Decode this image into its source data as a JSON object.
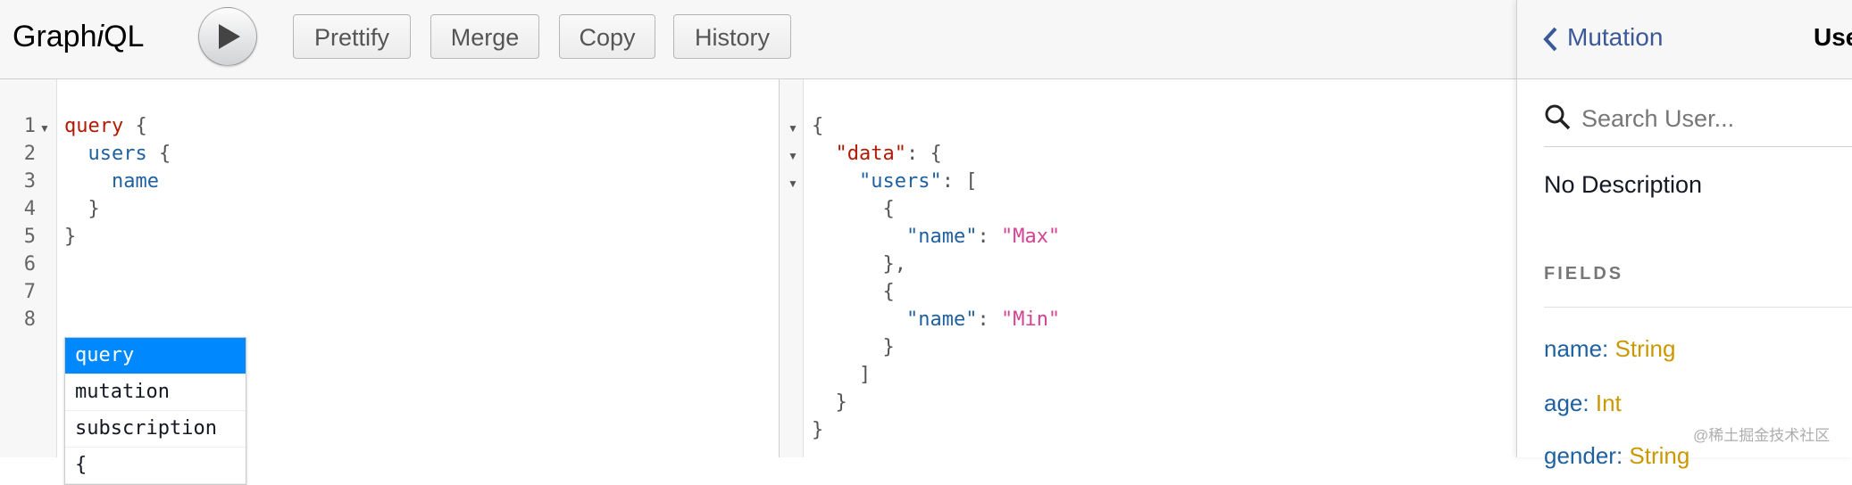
{
  "toolbar": {
    "logo_pre": "Graph",
    "logo_i": "i",
    "logo_post": "QL",
    "buttons": [
      "Prettify",
      "Merge",
      "Copy",
      "History"
    ]
  },
  "editor": {
    "line_numbers": [
      "1",
      "2",
      "3",
      "4",
      "5",
      "6",
      "7",
      "8"
    ],
    "lines": [
      [
        "query",
        " {"
      ],
      [
        "  ",
        "users",
        " {"
      ],
      [
        "    ",
        "name"
      ],
      [
        "  }"
      ],
      [
        "}"
      ]
    ],
    "autocomplete": [
      "query",
      "mutation",
      "subscription",
      "{"
    ]
  },
  "result": {
    "l1": "{",
    "data_key": "\"data\"",
    "users_key": "\"users\"",
    "name_key": "\"name\"",
    "val1": "\"Max\"",
    "val2": "\"Min\""
  },
  "docs": {
    "back_label": "Mutation",
    "title": "User",
    "search_placeholder": "Search User...",
    "description": "No Description",
    "fields_heading": "FIELDS",
    "fields": [
      {
        "name": "name",
        "type": "String"
      },
      {
        "name": "age",
        "type": "Int"
      },
      {
        "name": "gender",
        "type": "String"
      }
    ]
  },
  "watermark": "@稀土掘金技术社区",
  "colors": {
    "keyword": "#b11a04",
    "field": "#1f61a0",
    "string": "#d64292",
    "type": "#ca9800",
    "link": "#3b5998",
    "autocomplete_active": "#0088ff"
  }
}
